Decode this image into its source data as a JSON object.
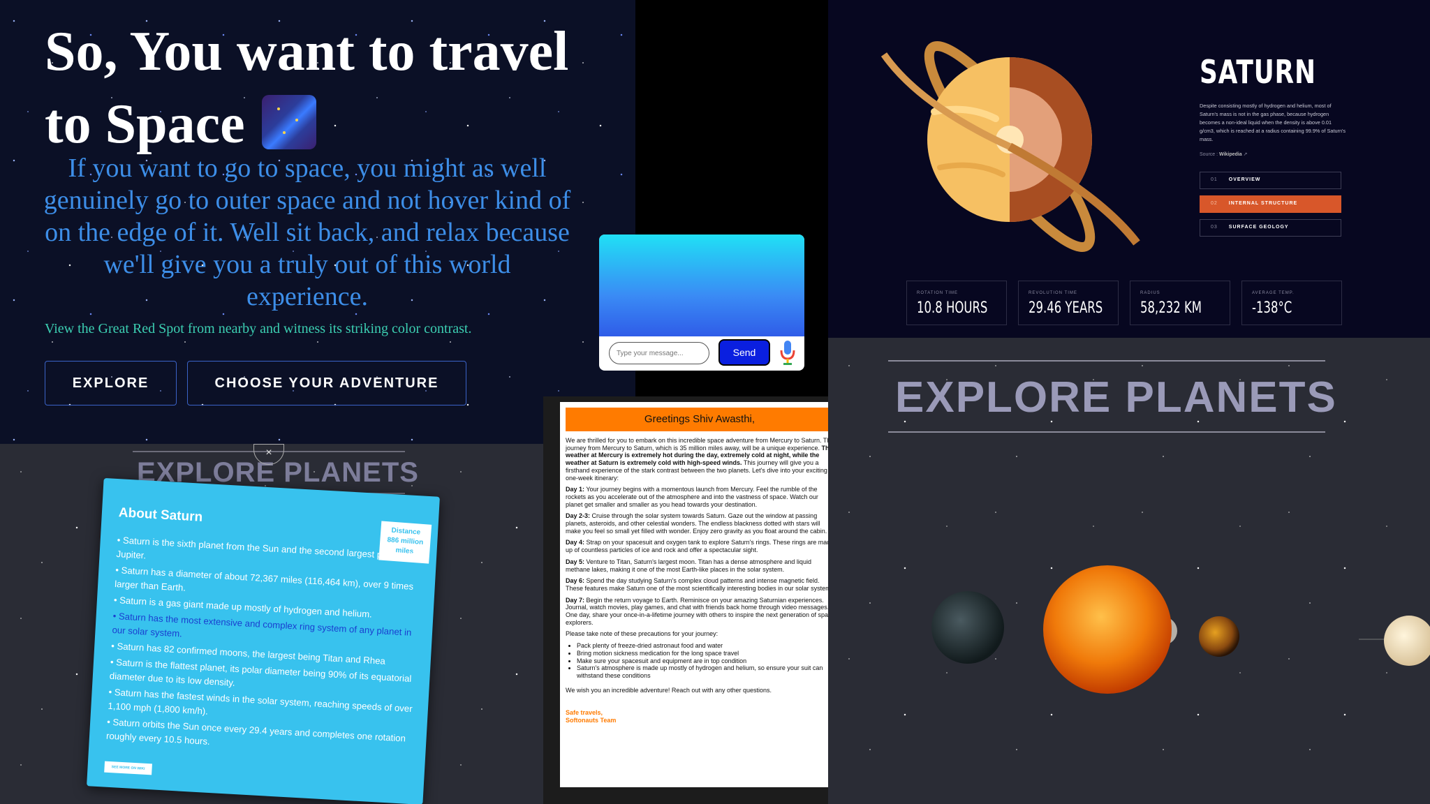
{
  "hero": {
    "title_line1": "So, You want to travel",
    "title_line2": "to Space",
    "subtitle": "If you want to go to space, you might as well genuinely go to outer space and not hover kind of on the edge of it. Well sit back, and relax because we'll give you a truly out of this world experience.",
    "note": "View the Great Red Spot from nearby and witness its striking color contrast.",
    "explore_label": "EXPLORE",
    "choose_label": "CHOOSE YOUR ADVENTURE",
    "badge_icon": "shooting-stars-icon"
  },
  "chat": {
    "input_placeholder": "Type your message...",
    "send_label": "Send",
    "mic_icon": "microphone-icon"
  },
  "saturn": {
    "title": "SATURN",
    "description": "Despite consisting mostly of hydrogen and helium, most of Saturn's mass is not in the gas phase, because hydrogen becomes a non-ideal liquid when the density is above 0.01 g/cm3, which is reached at a radius containing 99.9% of Saturn's mass.",
    "source_label": "Source :",
    "source_link": "Wikipedia",
    "tabs": [
      {
        "num": "01",
        "label": "OVERVIEW",
        "active": false
      },
      {
        "num": "02",
        "label": "INTERNAL STRUCTURE",
        "active": true
      },
      {
        "num": "03",
        "label": "SURFACE GEOLOGY",
        "active": false
      }
    ],
    "stats": [
      {
        "label": "ROTATION TIME",
        "value": "10.8 HOURS"
      },
      {
        "label": "REVOLUTION TIME",
        "value": "29.46 YEARS"
      },
      {
        "label": "RADIUS",
        "value": "58,232 KM"
      },
      {
        "label": "AVERAGE TEMP.",
        "value": "-138°C"
      }
    ],
    "accent": "#d8572a"
  },
  "about": {
    "heading": "EXPLORE PLANETS",
    "close_symbol": "×",
    "card_title": "About Saturn",
    "badge_line1": "Distance",
    "badge_line2": "886 million",
    "badge_line3": "miles",
    "facts": [
      "Saturn is the sixth planet from the Sun and the second largest planet after Jupiter.",
      "Saturn has a diameter of about 72,367 miles (116,464 km), over 9 times larger than Earth.",
      "Saturn is a gas giant made up mostly of hydrogen and helium.",
      "Saturn has the most extensive and complex ring system of any planet in our solar system.",
      "Saturn has 82 confirmed moons, the largest being Titan and Rhea",
      "Saturn is the flattest planet, its polar diameter being 90% of its equatorial diameter due to its low density.",
      "Saturn has the fastest winds in the solar system, reaching speeds of over 1,100 mph (1,800 km/h).",
      "Saturn orbits the Sun once every 29.4 years and completes one rotation roughly every 10.5 hours."
    ],
    "more_label": "SEE MORE ON WIKI",
    "card_color": "#38c2ee"
  },
  "letter": {
    "greeting": "Greetings Shiv Awasthi,",
    "intro_a": "We are thrilled for you to embark on this incredible space adventure from Mercury to Saturn. The journey from Mercury to Saturn, which is 35 million miles away, will be a unique experience.",
    "intro_bold": "The weather at Mercury is extremely hot during the day, extremely cold at night, while the weather at Saturn is extremely cold with high-speed winds.",
    "intro_b": "This journey will give you a firsthand experience of the stark contrast between the two planets. Let's dive into your exciting one-week itinerary:",
    "days": [
      {
        "label": "Day 1:",
        "text": "Your journey begins with a momentous launch from Mercury. Feel the rumble of the rockets as you accelerate out of the atmosphere and into the vastness of space. Watch our planet get smaller and smaller as you head towards your destination."
      },
      {
        "label": "Day 2-3:",
        "text": "Cruise through the solar system towards Saturn. Gaze out the window at passing planets, asteroids, and other celestial wonders. The endless blackness dotted with stars will make you feel so small yet filled with wonder. Enjoy zero gravity as you float around the cabin."
      },
      {
        "label": "Day 4:",
        "text": "Strap on your spacesuit and oxygen tank to explore Saturn's rings. These rings are made up of countless particles of ice and rock and offer a spectacular sight."
      },
      {
        "label": "Day 5:",
        "text": "Venture to Titan, Saturn's largest moon. Titan has a dense atmosphere and liquid methane lakes, making it one of the most Earth-like places in the solar system."
      },
      {
        "label": "Day 6:",
        "text": "Spend the day studying Saturn's complex cloud patterns and intense magnetic field. These features make Saturn one of the most scientifically interesting bodies in our solar system."
      },
      {
        "label": "Day 7:",
        "text": "Begin the return voyage to Earth. Reminisce on your amazing Saturnian experiences. Journal, watch movies, play games, and chat with friends back home through video messages. One day, share your once-in-a-lifetime journey with others to inspire the next generation of space explorers."
      }
    ],
    "precautions_intro": "Please take note of these precautions for your journey:",
    "precautions": [
      "Pack plenty of freeze-dried astronaut food and water",
      "Bring motion sickness medication for the long space travel",
      "Make sure your spacesuit and equipment are in top condition",
      "Saturn's atmosphere is made up mostly of hydrogen and helium, so ensure your suit can withstand these conditions"
    ],
    "closing": "We wish you an incredible adventure! Reach out with any other questions.",
    "sign1": "Safe travels,",
    "sign2": "Softonauts Team",
    "accent": "#ff7b00"
  },
  "planets": {
    "heading": "EXPLORE PLANETS"
  }
}
